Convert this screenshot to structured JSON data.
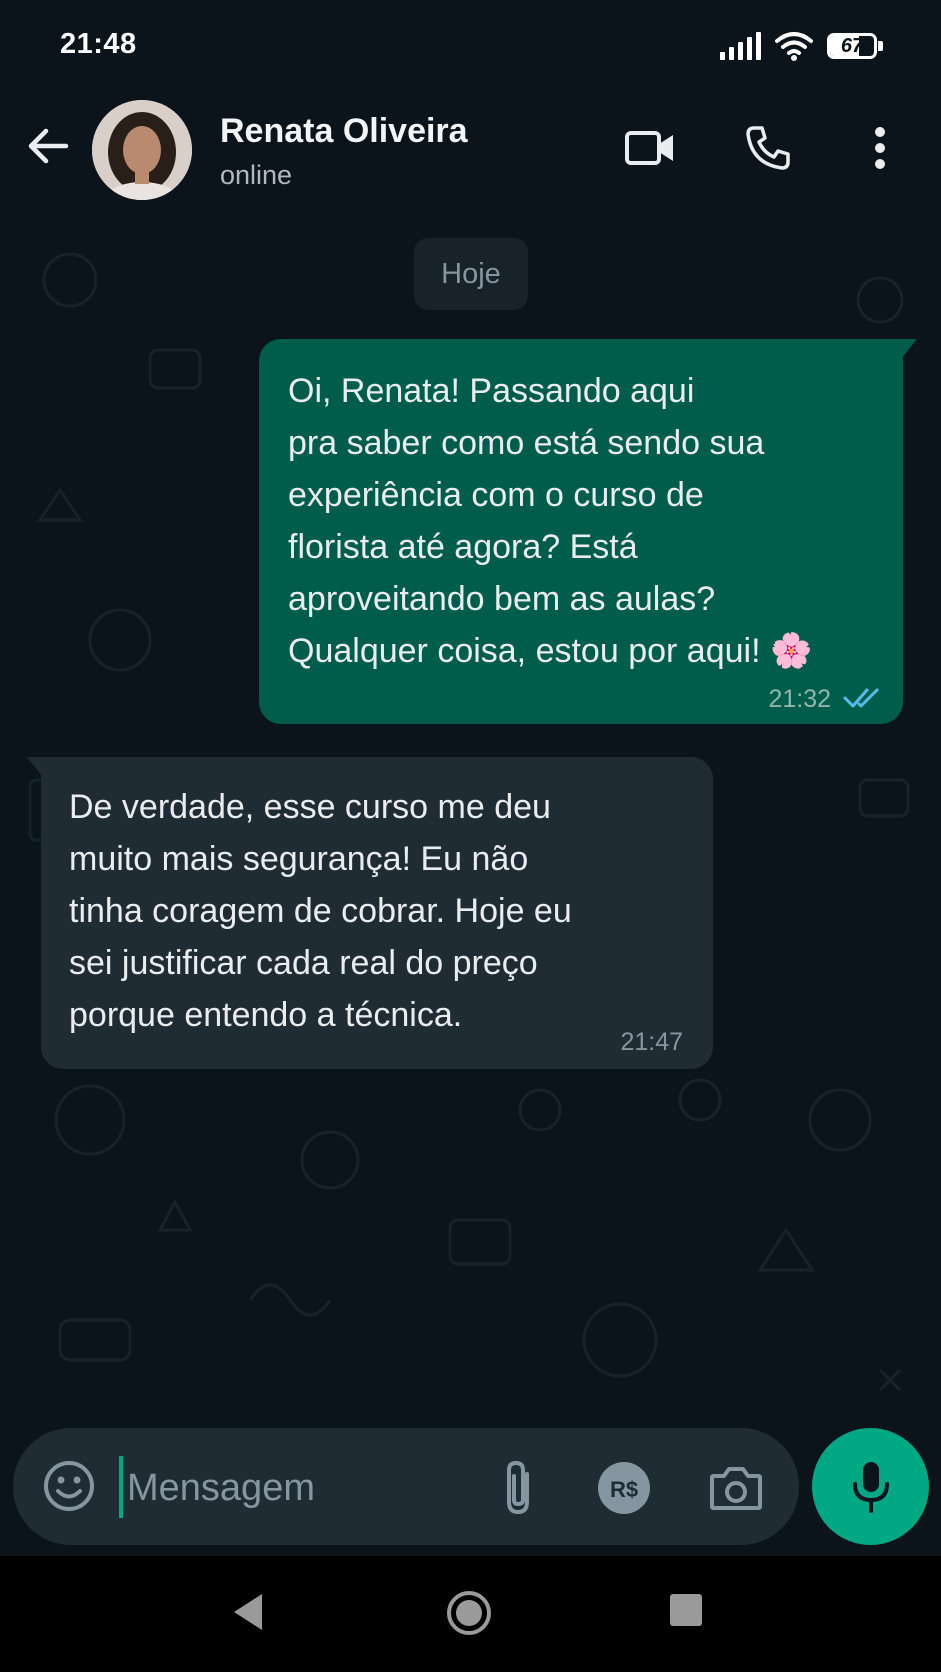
{
  "status_bar": {
    "time": "21:48",
    "battery": "67",
    "icons": [
      "signal-icon",
      "wifi-icon",
      "battery-icon"
    ]
  },
  "header": {
    "contact_name": "Renata Oliveira",
    "contact_status": "online",
    "actions": [
      "video-call-icon",
      "phone-icon",
      "more-vert-icon"
    ]
  },
  "chat": {
    "date_label": "Hoje",
    "messages": [
      {
        "direction": "outgoing",
        "text": "Oi, Renata! Passando aqui\npra saber como está sendo sua\nexperiência com o curso de\nflorista até agora? Está\naproveitando bem as aulas?\nQualquer coisa, estou por aqui! 🌸",
        "time": "21:32",
        "status": "read"
      },
      {
        "direction": "incoming",
        "text": "De verdade, esse curso me deu\nmuito mais segurança! Eu não\ntinha coragem de cobrar. Hoje eu\nsei justificar cada real do preço\nporque entendo a técnica.",
        "time": "21:47"
      }
    ]
  },
  "composer": {
    "placeholder": "Mensagem",
    "payment_label": "R$"
  },
  "colors": {
    "background": "#0b141a",
    "outgoing_bubble": "#005c4b",
    "incoming_bubble": "#202c33",
    "accent": "#00a884",
    "read_receipt": "#53bdeb"
  }
}
